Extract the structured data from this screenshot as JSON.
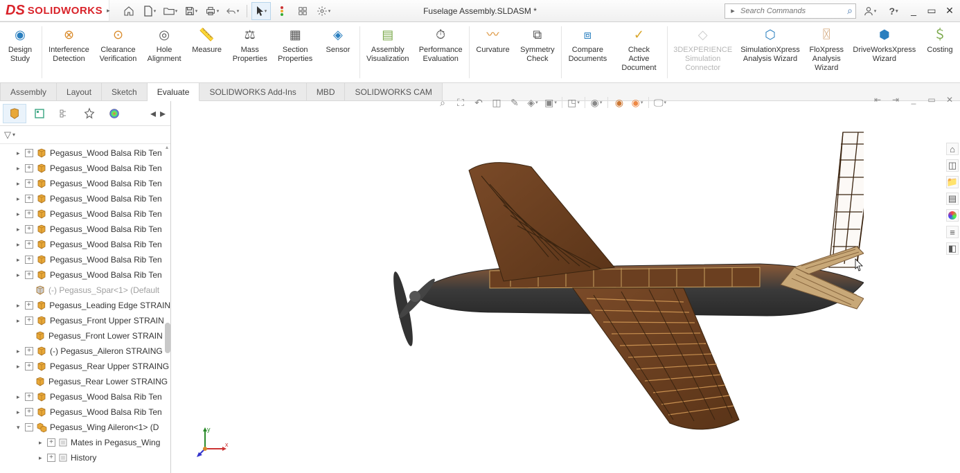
{
  "app": {
    "logo_prefix": "DS",
    "logo_text": "SOLIDWORKS"
  },
  "document": {
    "title": "Fuselage Assembly.SLDASM *"
  },
  "search": {
    "placeholder": "Search Commands"
  },
  "ribbon": [
    {
      "label": "Design\nStudy",
      "iconColor": "#2a7fbf"
    },
    {
      "label": "Interference\nDetection",
      "iconColor": "#d98a2a"
    },
    {
      "label": "Clearance\nVerification",
      "iconColor": "#d98a2a"
    },
    {
      "label": "Hole\nAlignment",
      "iconColor": "#555"
    },
    {
      "label": "Measure",
      "iconColor": "#d98a2a"
    },
    {
      "label": "Mass\nProperties",
      "iconColor": "#555"
    },
    {
      "label": "Section\nProperties",
      "iconColor": "#555"
    },
    {
      "label": "Sensor",
      "iconColor": "#2a7fbf"
    },
    {
      "label": "Assembly\nVisualization",
      "iconColor": "#7aa84a"
    },
    {
      "label": "Performance\nEvaluation",
      "iconColor": "#555"
    },
    {
      "label": "Curvature",
      "iconColor": "#d98a2a"
    },
    {
      "label": "Symmetry\nCheck",
      "iconColor": "#555"
    },
    {
      "label": "Compare\nDocuments",
      "iconColor": "#2a7fbf"
    },
    {
      "label": "Check Active\nDocument",
      "iconColor": "#d9a62a"
    },
    {
      "label": "3DEXPERIENCE\nSimulation\nConnector",
      "disabled": true
    },
    {
      "label": "SimulationXpress\nAnalysis Wizard",
      "iconColor": "#2a7fbf"
    },
    {
      "label": "FloXpress\nAnalysis\nWizard",
      "iconColor": "#c96"
    },
    {
      "label": "DriveWorksXpress\nWizard",
      "iconColor": "#2a7fbf"
    },
    {
      "label": "Costing",
      "iconColor": "#7aa84a"
    }
  ],
  "tabs": [
    "Assembly",
    "Layout",
    "Sketch",
    "Evaluate",
    "SOLIDWORKS Add-Ins",
    "MBD",
    "SOLIDWORKS CAM"
  ],
  "active_tab": "Evaluate",
  "tree": [
    {
      "label": "Pegasus_Wood Balsa Rib Ten",
      "expandable": true
    },
    {
      "label": "Pegasus_Wood Balsa Rib Ten",
      "expandable": true
    },
    {
      "label": "Pegasus_Wood Balsa Rib Ten",
      "expandable": true
    },
    {
      "label": "Pegasus_Wood Balsa Rib Ten",
      "expandable": true
    },
    {
      "label": "Pegasus_Wood Balsa Rib Ten",
      "expandable": true
    },
    {
      "label": "Pegasus_Wood Balsa Rib Ten",
      "expandable": true
    },
    {
      "label": "Pegasus_Wood Balsa Rib Ten",
      "expandable": true
    },
    {
      "label": "Pegasus_Wood Balsa Rib Ten",
      "expandable": true
    },
    {
      "label": "Pegasus_Wood Balsa Rib Ten",
      "expandable": true
    },
    {
      "label": "(-) Pegasus_Spar<1> (Default",
      "faded": true
    },
    {
      "label": "Pegasus_Leading Edge STRAIN",
      "expandable": true
    },
    {
      "label": "Pegasus_Front Upper STRAIN",
      "expandable": true
    },
    {
      "label": "Pegasus_Front Lower STRAIN"
    },
    {
      "label": "(-) Pegasus_Aileron STRAING",
      "expandable": true
    },
    {
      "label": "Pegasus_Rear Upper STRAING",
      "expandable": true
    },
    {
      "label": "Pegasus_Rear Lower STRAING"
    },
    {
      "label": "Pegasus_Wood Balsa Rib Ten",
      "expandable": true
    },
    {
      "label": "Pegasus_Wood Balsa Rib Ten",
      "expandable": true
    },
    {
      "label": "Pegasus_Wing Aileron<1> (D",
      "expandable": true,
      "expanded": true,
      "subassy": true
    },
    {
      "label": "Mates in Pegasus_Wing",
      "child": true,
      "expandable": true,
      "mates": true
    },
    {
      "label": "History",
      "child": true,
      "expandable": true,
      "mates": true
    }
  ],
  "triad": {
    "x": "x",
    "y": "y"
  }
}
